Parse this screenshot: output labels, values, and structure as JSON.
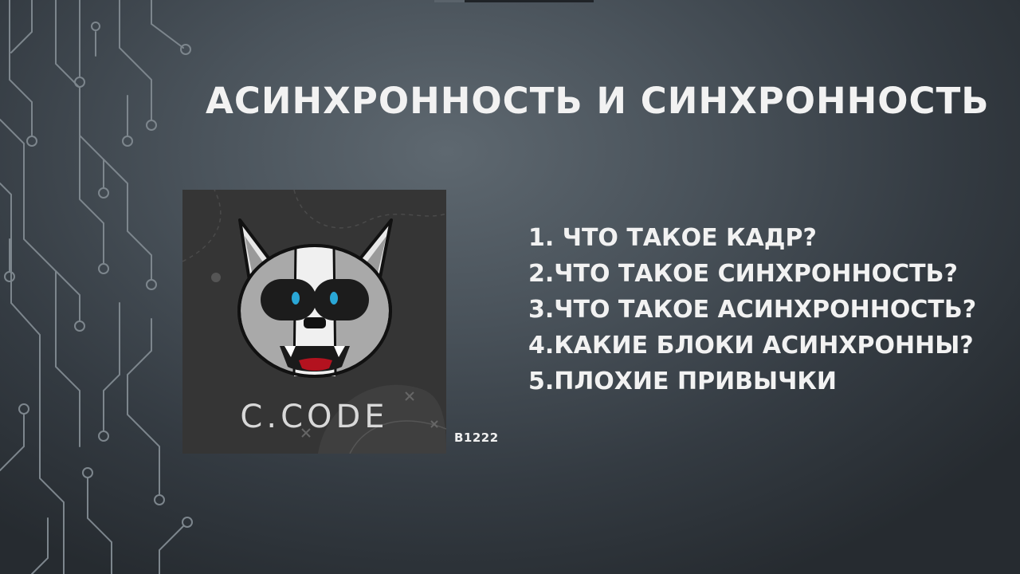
{
  "slide": {
    "title": "Асинхронность и синхронность",
    "agenda": [
      "1. Что такое кадр?",
      "2.Что такое синхронность?",
      "3.Что такое асинхронность?",
      "4.Какие блоки асинхронны?",
      "5.Плохие привычки"
    ],
    "code_label": "B1222"
  },
  "logo": {
    "brand_text": "C.CODE",
    "background_color": "#353535",
    "eye_color": "#2aa7d6",
    "mouth_color": "#b3121f"
  },
  "decor": {
    "circuit_icon": "circuit-board-icon",
    "line_color": "#7d868d"
  }
}
